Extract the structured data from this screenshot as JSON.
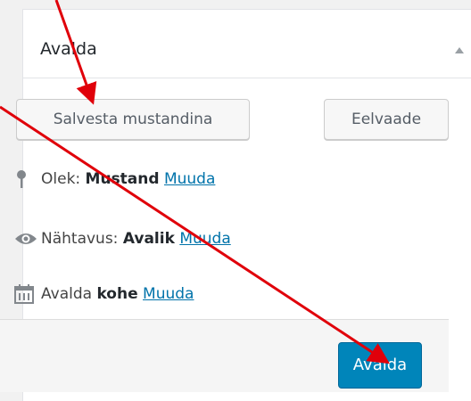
{
  "box": {
    "title": "Avalda",
    "toggle_icon": "triangle-up-icon"
  },
  "actions": {
    "save_draft_label": "Salvesta mustandina",
    "preview_label": "Eelvaade"
  },
  "status": {
    "icon": "pin-icon",
    "label": "Olek:",
    "value": "Mustand",
    "link": "Muuda"
  },
  "visibility": {
    "icon": "eye-icon",
    "label": "Nähtavus:",
    "value": "Avalik",
    "link": "Muuda"
  },
  "schedule": {
    "icon": "calendar-icon",
    "label": "Avalda",
    "value": "kohe",
    "link": "Muuda"
  },
  "footer": {
    "publish_label": "Avalda"
  },
  "colors": {
    "primary": "#0085ba",
    "link": "#0073aa",
    "annotation": "#e0000a"
  }
}
